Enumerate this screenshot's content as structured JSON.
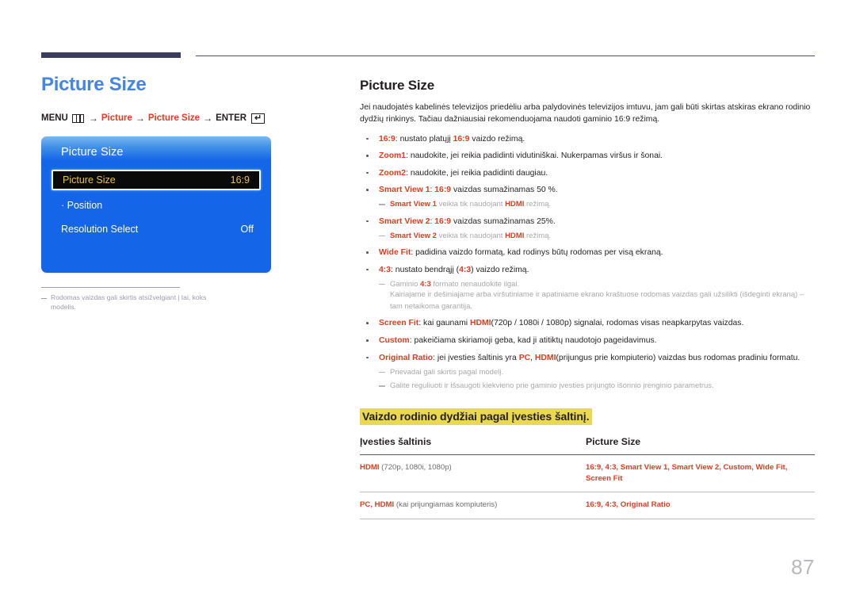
{
  "page": {
    "number": "87"
  },
  "left": {
    "title": "Picture Size",
    "menu_path": {
      "menu_label": "MENU",
      "menu_icon": "menu-bars-icon",
      "arrow1": "→",
      "item1": "Picture",
      "arrow2": "→",
      "item2": "Picture Size",
      "arrow3": "→",
      "enter_label": "ENTER",
      "enter_icon": "↵"
    },
    "osd": {
      "title": "Picture Size",
      "rows": [
        {
          "label": "Picture Size",
          "value": "16:9",
          "selected": true
        },
        {
          "label": "· Position",
          "value": "",
          "selected": false
        },
        {
          "label": "Resolution Select",
          "value": "Off",
          "selected": false
        }
      ]
    },
    "footnote": "Rodomas vaizdas gali skirtis atsižvelgiant į tai, koks modelis."
  },
  "right": {
    "title": "Picture Size",
    "intro": "Jei naudojatės kabelinės televizijos priedėliu arba palydovinės televizijos imtuvu, jam gali būti skirtas atskiras ekrano rodinio dydžių rinkinys. Tačiau dažniausiai rekomenduojama naudoti gaminio 16:9 režimą.",
    "bullets": {
      "b1": {
        "term": "16:9",
        "rest_a": ": nustato platųjį ",
        "inline": "16:9",
        "rest_b": " vaizdo režimą."
      },
      "b2": {
        "term": "Zoom1",
        "rest": ": naudokite, jei reikia padidinti vidutiniškai. Nukerpamas viršus ir šonai."
      },
      "b3": {
        "term": "Zoom2",
        "rest": ": naudokite, jei reikia padidinti daugiau."
      },
      "b4": {
        "term": "Smart View 1",
        "sep": ": ",
        "inline": "16:9",
        "rest": " vaizdas sumažinamas 50 %."
      },
      "b4note": {
        "term": "Smart View 1",
        "mid": " veikia tik naudojant ",
        "term2": "HDMI",
        "end": " režimą."
      },
      "b5": {
        "term": "Smart View 2",
        "sep": ": ",
        "inline": "16:9",
        "rest": " vaizdas sumažinamas 25%."
      },
      "b5note": {
        "term": "Smart View 2",
        "mid": " veikia tik naudojant ",
        "term2": "HDMI",
        "end": "  režimą."
      },
      "b6": {
        "term": "Wide Fit",
        "rest": ": padidina vaizdo formatą, kad rodinys būtų rodomas per visą ekraną."
      },
      "b7": {
        "term": "4:3",
        "rest_a": ": nustato bendrąjį (",
        "inline": "4:3",
        "rest_b": ") vaizdo režimą."
      },
      "b7note1a": "Gaminio ",
      "b7note1b": "4:3",
      "b7note1c": " formato nenaudokite ilgai.",
      "b7note2": "Kairiajame ir dešiniajame arba viršutiniame ir apatiniame ekrano kraštuose rodomas vaizdas gali užsilikti (išdeginti ekraną) – tam netaikoma garantija.",
      "b8": {
        "term": "Screen Fit",
        "mid": ": kai gaunami ",
        "term2": "HDMI",
        "rest": "(720p / 1080i / 1080p) signalai, rodomas visas neapkarpytas vaizdas."
      },
      "b9": {
        "term": "Custom",
        "rest": ": pakeičiama skiriamoji geba, kad ji atitiktų naudotojo pageidavimus."
      },
      "b10": {
        "term": "Original Ratio",
        "mid": ": jei įvesties šaltinis yra ",
        "term2": "PC",
        "comma": ", ",
        "term3": "HDMI",
        "rest": "(prijungus prie kompiuterio) vaizdas bus rodomas pradiniu formatu."
      },
      "b10note1": "Prievadai gali skirtis pagal modelį.",
      "b10note2": "Galite reguliuoti ir išsaugoti kiekvieno prie gaminio įvesties prijungto išorinio įrenginio parametrus."
    },
    "section_heading": "Vaizdo rodinio dydžiai pagal įvesties šaltinį.",
    "table": {
      "headers": [
        "Įvesties šaltinis",
        "Picture Size"
      ],
      "rows": [
        {
          "source_main": "HDMI",
          "source_note": " (720p, 1080i, 1080p)",
          "value": "16:9, 4:3, Smart View 1, Smart View 2, Custom, Wide Fit, Screen Fit"
        },
        {
          "source_main": "PC, HDMI",
          "source_note": " (kai prijungiamas kompiuteris)",
          "value": "16:9, 4:3, Original Ratio"
        }
      ]
    }
  },
  "colors": {
    "accent_red": "#e03c1f",
    "title_blue": "#4485e8",
    "highlight_yellow": "#ead84f",
    "osd_blue": "#1565e8",
    "osd_gold": "#e8c24a",
    "rule_navy": "#3a3c5e"
  }
}
